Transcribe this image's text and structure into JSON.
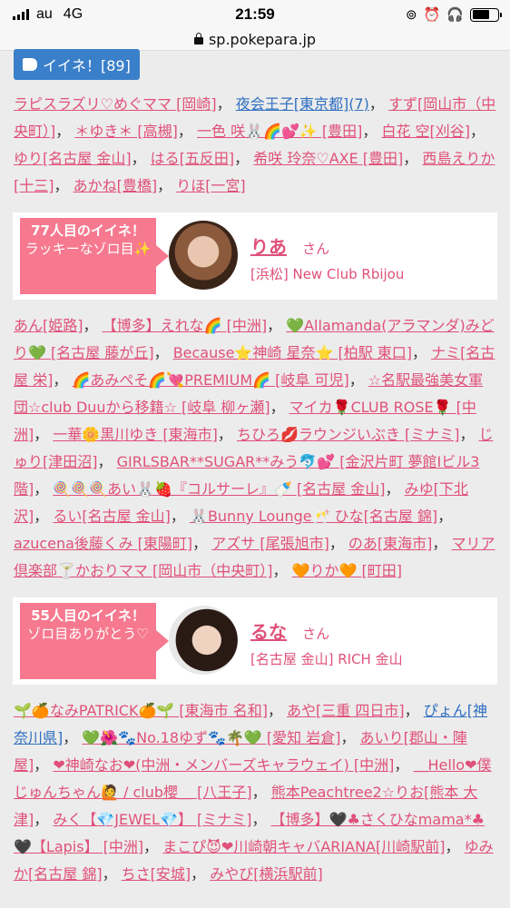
{
  "status": {
    "carrier": "au",
    "network": "4G",
    "time": "21:59",
    "url": "sp.pokepara.jp"
  },
  "iine_button": {
    "label": "イイネ！[89]"
  },
  "likers_top": [
    "ラピスラズリ♡めぐママ [岡崎]",
    "夜会王子[東京都](7)",
    "すず[岡山市（中央町）]",
    "＊ゆき＊ [高槻]",
    "一色 咲🐰🌈💕✨ [豊田]",
    "白花 空[刈谷]",
    "ゆり[名古屋 金山]",
    "はる[五反田]",
    "希咲 玲奈♡AXE [豊田]",
    "西島えりか[十三]",
    "あかね[豊橋]",
    "りほ[一宮]"
  ],
  "card1": {
    "ribbon_1": "77人目のイイネ！",
    "ribbon_2": "ラッキーなゾロ目✨",
    "name": "りあ",
    "san": "さん",
    "shop": "[浜松] New Club Rbijou"
  },
  "likers_mid": [
    "あん[姫路]",
    "【博多】えれな🌈 [中洲]",
    "💚Allamanda(アラマンダ)みどり💚 [名古屋 藤が丘]",
    "Because⭐神崎 星奈⭐ [柏駅 東口]",
    "ナミ[名古屋 栄]",
    "🌈あみぺそ🌈💘PREMIUM🌈 [岐阜 可児]",
    "☆名駅最強美女軍団☆club Duuから移籍☆ [岐阜 柳ヶ瀬]",
    "マイカ🌹CLUB ROSE🌹 [中洲]",
    "一華🌼黒川ゆき [東海市]",
    "ちひろ💋ラウンジいぶき [ミナミ]",
    "じゅり[津田沼]",
    "GIRLSBAR**SUGAR**みう🐬💕 [金沢片町 夢館Ⅰビル3階]",
    "🍭🍭🍭あい🐰🍓『コルサーレ』🍼 [名古屋 金山]",
    "みゆ[下北沢]",
    "るい[名古屋 金山]",
    "🐰Bunny Lounge🥂 ひな[名古屋 錦]",
    "azucena後藤くみ [東陽町]",
    "アズサ [尾張旭市]",
    "のあ[東海市]",
    "マリア倶楽部🍸かおりママ [岡山市（中央町）]",
    "🧡りか🧡 [町田]"
  ],
  "card2": {
    "ribbon_1": "55人目のイイネ！",
    "ribbon_2": "ゾロ目ありがとう♡",
    "name": "るな",
    "san": "さん",
    "shop": "[名古屋 金山] RICH 金山"
  },
  "likers_bottom": [
    "🌱🍊なみPATRICK🍊🌱 [東海市 名和]",
    "あや[三重 四日市]",
    "ぴょん[神奈川県]",
    "💚🌺🐾No.18ゆず🐾🌴💚 [愛知 岩倉]",
    "あいり[郡山・陣屋]",
    "❤神崎なお❤(中洲・メンバーズキャラウェイ) [中洲]",
    "＿Hello❤僕じゅんちゃん🙋 / club櫻＿ [八王子]",
    "熊本Peachtree2☆りお[熊本 大津]",
    "みく【💎JEWEL💎】 [ミナミ]",
    "【博多】🖤♣さくひなmama*♣🖤【Lapis】 [中洲]",
    "まこぴ😈❤川崎朝キャバARIANA[川崎駅前]",
    "ゆみか[名古屋 錦]",
    "ちさ[安城]",
    "みやび[横浜駅前]"
  ]
}
